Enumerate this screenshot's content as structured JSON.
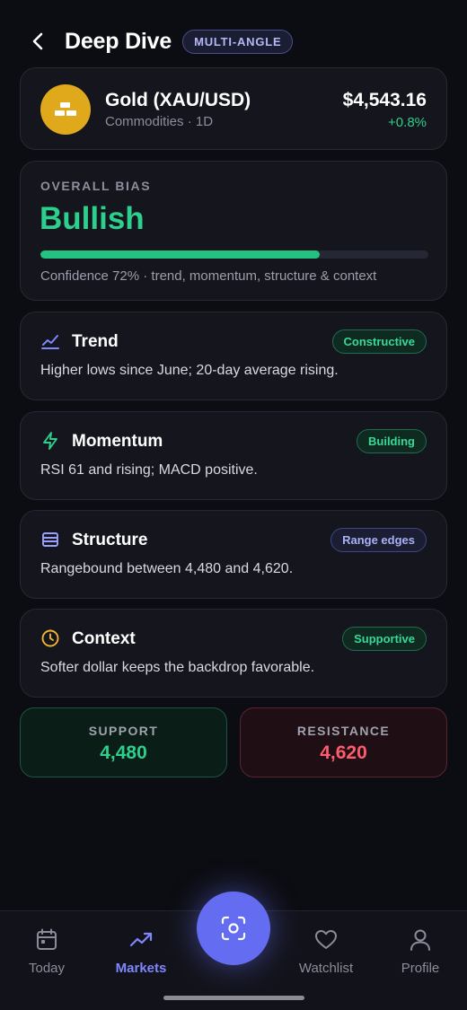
{
  "header": {
    "title": "Deep Dive",
    "badge": "MULTI-ANGLE",
    "back_icon": "chevron-left-icon"
  },
  "asset": {
    "name": "Gold (XAU/USD)",
    "meta": "Commodities · 1D",
    "price": "$4,543.16",
    "change": "+0.8%",
    "icon": "gold-bars-icon",
    "icon_color": "#e0a81b"
  },
  "bias": {
    "label": "OVERALL BIAS",
    "value": "Bullish",
    "confidence": 0.72,
    "caption": "Confidence 72% · trend, momentum, structure & context",
    "color": "#2dcf8c"
  },
  "factors": [
    {
      "title": "Trend",
      "tag": "Constructive",
      "tag_style": "green",
      "description": "Higher lows since June; 20-day average rising.",
      "icon": "trend-line-icon",
      "icon_color": "#7f86ff"
    },
    {
      "title": "Momentum",
      "tag": "Building",
      "tag_style": "green",
      "description": "RSI 61 and rising; MACD positive.",
      "icon": "lightning-icon",
      "icon_color": "#2dcf8c"
    },
    {
      "title": "Structure",
      "tag": "Range edges",
      "tag_style": "blue",
      "description": "Rangebound between 4,480 and 4,620.",
      "icon": "layers-icon",
      "icon_color": "#9aa0ff"
    },
    {
      "title": "Context",
      "tag": "Supportive",
      "tag_style": "green",
      "description": "Softer dollar keeps the backdrop favorable.",
      "icon": "clock-icon",
      "icon_color": "#f2b632"
    }
  ],
  "levels": {
    "support": {
      "label": "SUPPORT",
      "value": "4,480"
    },
    "resistance": {
      "label": "RESISTANCE",
      "value": "4,620"
    }
  },
  "tabbar": {
    "items": [
      {
        "label": "Today",
        "icon": "calendar-icon",
        "active": false
      },
      {
        "label": "Markets",
        "icon": "trending-up-icon",
        "active": true
      },
      {
        "label": "Watchlist",
        "icon": "heart-icon",
        "active": false
      },
      {
        "label": "Profile",
        "icon": "user-icon",
        "active": false
      }
    ],
    "fab_icon": "scan-icon"
  },
  "colors": {
    "background": "#0c0d12",
    "accent": "#646cf2",
    "bullish": "#2dcf8c",
    "bearish": "#ff5b6e"
  }
}
